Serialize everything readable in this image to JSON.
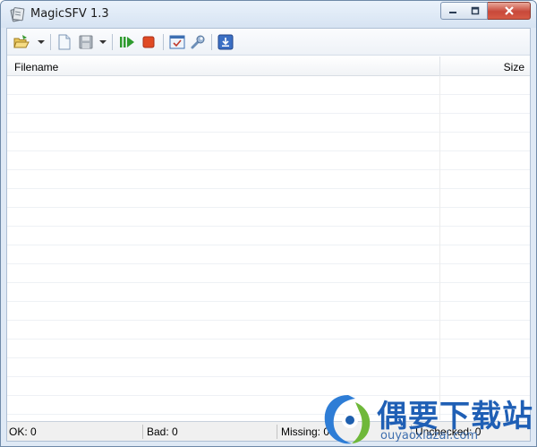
{
  "window": {
    "title": "MagicSFV 1.3",
    "accent": "#dfe9f5",
    "close_color": "#c8493a"
  },
  "toolbar": {
    "items": [
      {
        "icon": "open-folder-icon"
      },
      {
        "icon": "new-file-icon"
      },
      {
        "icon": "save-icon"
      },
      {
        "icon": "start-check-icon"
      },
      {
        "icon": "stop-icon"
      },
      {
        "icon": "options-icon"
      },
      {
        "icon": "tools-icon"
      },
      {
        "icon": "update-icon"
      }
    ]
  },
  "list": {
    "columns": [
      "Filename",
      "Size"
    ],
    "rows": []
  },
  "status": {
    "ok": "OK: 0",
    "bad": "Bad: 0",
    "missing": "Missing: 0",
    "unchecked": "Unchecked: 0"
  },
  "watermark": {
    "line1": "偶要下载站",
    "line2": "ouyaoxiazai.com"
  }
}
